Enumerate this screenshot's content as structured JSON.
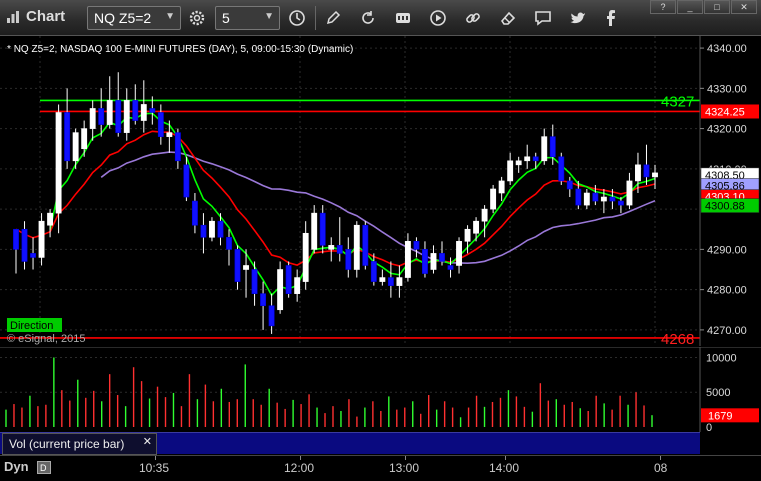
{
  "toolbar": {
    "title": "Chart",
    "symbol": "NQ Z5=2",
    "interval": "5",
    "window_controls": [
      "?",
      "_",
      "□",
      "✕"
    ]
  },
  "chart_data": [
    {
      "type": "candlestick",
      "title": "NQ Z5=2, NASDAQ 100 E-MINI FUTURES (DAY), 5, 09:00-15:30 (Dynamic)",
      "title_prefix": "*",
      "ylim": [
        4266,
        4343
      ],
      "y_ticks": [
        "4340.00",
        "4330.00",
        "4320.00",
        "4310.00",
        "4290.00",
        "4280.00",
        "4270.00"
      ],
      "x_ticks": [
        "10:35",
        "12:00",
        "13:00",
        "14:00",
        "08"
      ],
      "candles": [
        {
          "o": 4290,
          "h": 4294,
          "l": 4284,
          "c": 4295,
          "up": false
        },
        {
          "o": 4295,
          "h": 4297,
          "l": 4285,
          "c": 4287,
          "up": false
        },
        {
          "o": 4289,
          "h": 4293,
          "l": 4285,
          "c": 4288,
          "up": false
        },
        {
          "o": 4288,
          "h": 4299,
          "l": 4286,
          "c": 4297,
          "up": true
        },
        {
          "o": 4296,
          "h": 4300,
          "l": 4293,
          "c": 4299,
          "up": true
        },
        {
          "o": 4299,
          "h": 4326,
          "l": 4294,
          "c": 4324,
          "up": true
        },
        {
          "o": 4324,
          "h": 4330,
          "l": 4310,
          "c": 4312,
          "up": false
        },
        {
          "o": 4312,
          "h": 4320,
          "l": 4310,
          "c": 4319,
          "up": true
        },
        {
          "o": 4315,
          "h": 4322,
          "l": 4313,
          "c": 4320,
          "up": true
        },
        {
          "o": 4320,
          "h": 4327,
          "l": 4317,
          "c": 4325,
          "up": true
        },
        {
          "o": 4325,
          "h": 4330,
          "l": 4318,
          "c": 4321,
          "up": false
        },
        {
          "o": 4321,
          "h": 4333,
          "l": 4320,
          "c": 4327,
          "up": true
        },
        {
          "o": 4327,
          "h": 4334,
          "l": 4318,
          "c": 4319,
          "up": false
        },
        {
          "o": 4319,
          "h": 4330,
          "l": 4317,
          "c": 4327,
          "up": true
        },
        {
          "o": 4327,
          "h": 4331,
          "l": 4321,
          "c": 4322,
          "up": false
        },
        {
          "o": 4322,
          "h": 4332,
          "l": 4319,
          "c": 4326,
          "up": true
        },
        {
          "o": 4325,
          "h": 4328,
          "l": 4321,
          "c": 4324,
          "up": false
        },
        {
          "o": 4324,
          "h": 4326,
          "l": 4316,
          "c": 4318,
          "up": false
        },
        {
          "o": 4318,
          "h": 4322,
          "l": 4314,
          "c": 4319,
          "up": true
        },
        {
          "o": 4319,
          "h": 4320,
          "l": 4310,
          "c": 4312,
          "up": false
        },
        {
          "o": 4311,
          "h": 4313,
          "l": 4302,
          "c": 4303,
          "up": false
        },
        {
          "o": 4302,
          "h": 4304,
          "l": 4294,
          "c": 4296,
          "up": false
        },
        {
          "o": 4296,
          "h": 4299,
          "l": 4289,
          "c": 4293,
          "up": false
        },
        {
          "o": 4293,
          "h": 4298,
          "l": 4292,
          "c": 4297,
          "up": true
        },
        {
          "o": 4297,
          "h": 4299,
          "l": 4291,
          "c": 4293,
          "up": false
        },
        {
          "o": 4293,
          "h": 4295,
          "l": 4286,
          "c": 4290,
          "up": false
        },
        {
          "o": 4290,
          "h": 4291,
          "l": 4280,
          "c": 4282,
          "up": false
        },
        {
          "o": 4286,
          "h": 4290,
          "l": 4278,
          "c": 4285,
          "up": true
        },
        {
          "o": 4285,
          "h": 4287,
          "l": 4276,
          "c": 4279,
          "up": false
        },
        {
          "o": 4279,
          "h": 4282,
          "l": 4270,
          "c": 4276,
          "up": false
        },
        {
          "o": 4276,
          "h": 4279,
          "l": 4269,
          "c": 4271,
          "up": false
        },
        {
          "o": 4275,
          "h": 4287,
          "l": 4274,
          "c": 4285,
          "up": true
        },
        {
          "o": 4286,
          "h": 4287,
          "l": 4278,
          "c": 4279,
          "up": false
        },
        {
          "o": 4279,
          "h": 4285,
          "l": 4277,
          "c": 4283,
          "up": true
        },
        {
          "o": 4282,
          "h": 4297,
          "l": 4280,
          "c": 4294,
          "up": true
        },
        {
          "o": 4290,
          "h": 4301,
          "l": 4289,
          "c": 4299,
          "up": true
        },
        {
          "o": 4299,
          "h": 4301,
          "l": 4289,
          "c": 4291,
          "up": false
        },
        {
          "o": 4290,
          "h": 4293,
          "l": 4287,
          "c": 4291,
          "up": true
        },
        {
          "o": 4291,
          "h": 4298,
          "l": 4287,
          "c": 4289,
          "up": false
        },
        {
          "o": 4290,
          "h": 4293,
          "l": 4283,
          "c": 4285,
          "up": false
        },
        {
          "o": 4285,
          "h": 4297,
          "l": 4283,
          "c": 4296,
          "up": true
        },
        {
          "o": 4296,
          "h": 4297,
          "l": 4285,
          "c": 4286,
          "up": false
        },
        {
          "o": 4287,
          "h": 4289,
          "l": 4281,
          "c": 4282,
          "up": false
        },
        {
          "o": 4282,
          "h": 4285,
          "l": 4281,
          "c": 4283,
          "up": true
        },
        {
          "o": 4283,
          "h": 4287,
          "l": 4278,
          "c": 4281,
          "up": false
        },
        {
          "o": 4281,
          "h": 4286,
          "l": 4278,
          "c": 4283,
          "up": true
        },
        {
          "o": 4283,
          "h": 4294,
          "l": 4282,
          "c": 4292,
          "up": true
        },
        {
          "o": 4292,
          "h": 4293,
          "l": 4288,
          "c": 4290,
          "up": false
        },
        {
          "o": 4290,
          "h": 4292,
          "l": 4283,
          "c": 4284,
          "up": false
        },
        {
          "o": 4285,
          "h": 4291,
          "l": 4284,
          "c": 4289,
          "up": true
        },
        {
          "o": 4289,
          "h": 4292,
          "l": 4286,
          "c": 4287,
          "up": false
        },
        {
          "o": 4286,
          "h": 4288,
          "l": 4283,
          "c": 4285,
          "up": false
        },
        {
          "o": 4286,
          "h": 4293,
          "l": 4284,
          "c": 4292,
          "up": true
        },
        {
          "o": 4292,
          "h": 4296,
          "l": 4289,
          "c": 4295,
          "up": true
        },
        {
          "o": 4294,
          "h": 4298,
          "l": 4292,
          "c": 4297,
          "up": true
        },
        {
          "o": 4297,
          "h": 4301,
          "l": 4293,
          "c": 4300,
          "up": true
        },
        {
          "o": 4300,
          "h": 4306,
          "l": 4299,
          "c": 4305,
          "up": true
        },
        {
          "o": 4304,
          "h": 4308,
          "l": 4302,
          "c": 4307,
          "up": true
        },
        {
          "o": 4307,
          "h": 4314,
          "l": 4306,
          "c": 4312,
          "up": true
        },
        {
          "o": 4311,
          "h": 4313,
          "l": 4309,
          "c": 4312,
          "up": true
        },
        {
          "o": 4312,
          "h": 4316,
          "l": 4310,
          "c": 4313,
          "up": true
        },
        {
          "o": 4313,
          "h": 4314,
          "l": 4310,
          "c": 4312,
          "up": false
        },
        {
          "o": 4312,
          "h": 4320,
          "l": 4311,
          "c": 4318,
          "up": true
        },
        {
          "o": 4318,
          "h": 4321,
          "l": 4311,
          "c": 4313,
          "up": false
        },
        {
          "o": 4313,
          "h": 4314,
          "l": 4306,
          "c": 4307,
          "up": false
        },
        {
          "o": 4307,
          "h": 4308,
          "l": 4303,
          "c": 4305,
          "up": false
        },
        {
          "o": 4305,
          "h": 4307,
          "l": 4300,
          "c": 4301,
          "up": false
        },
        {
          "o": 4301,
          "h": 4305,
          "l": 4300,
          "c": 4304,
          "up": true
        },
        {
          "o": 4304,
          "h": 4306,
          "l": 4301,
          "c": 4302,
          "up": false
        },
        {
          "o": 4302,
          "h": 4305,
          "l": 4299,
          "c": 4303,
          "up": true
        },
        {
          "o": 4303,
          "h": 4305,
          "l": 4300,
          "c": 4302,
          "up": false
        },
        {
          "o": 4302,
          "h": 4303,
          "l": 4299,
          "c": 4301,
          "up": false
        },
        {
          "o": 4301,
          "h": 4309,
          "l": 4300,
          "c": 4307,
          "up": true
        },
        {
          "o": 4307,
          "h": 4314,
          "l": 4304,
          "c": 4311,
          "up": true
        },
        {
          "o": 4311,
          "h": 4316,
          "l": 4306,
          "c": 4308,
          "up": false
        },
        {
          "o": 4308,
          "h": 4311,
          "l": 4305,
          "c": 4309,
          "up": true
        }
      ],
      "hlines": [
        {
          "value": 4327,
          "color": "#00ff00",
          "label": "4327"
        },
        {
          "value": 4324.25,
          "color": "#ff0000",
          "label": "4324.25"
        },
        {
          "value": 4268,
          "color": "#ff0000",
          "label": "4268"
        }
      ],
      "price_tags": [
        {
          "value": 4308.5,
          "label": "4308.50",
          "bg": "#ffffff",
          "fg": "#000000"
        },
        {
          "value": 4305.86,
          "label": "4305.86",
          "bg": "#a0a0ff",
          "fg": "#000000"
        },
        {
          "value": 4303.1,
          "label": "4303.10",
          "bg": "#ff0000",
          "fg": "#ffffff"
        },
        {
          "value": 4300.88,
          "label": "4300.88",
          "bg": "#00cc00",
          "fg": "#000000"
        }
      ],
      "series_colors": {
        "ma_red": "#ff0000",
        "ma_green": "#00ff00",
        "ma_purple": "#9a78d8",
        "up": "#ffffff",
        "down": "#1010ff"
      },
      "footer_labels": {
        "direction": "Direction",
        "copyright": "© eSignal, 2015"
      }
    },
    {
      "type": "bar",
      "title": "Vol (current price bar)",
      "ylim": [
        0,
        10500
      ],
      "y_ticks": [
        "10000",
        "5000",
        "0"
      ],
      "current_value": "1679",
      "values": [
        2500,
        3300,
        2800,
        4500,
        3000,
        3200,
        10000,
        5300,
        3800,
        6800,
        4200,
        5200,
        3700,
        7600,
        4600,
        3000,
        8600,
        6600,
        4100,
        5800,
        4300,
        4900,
        3000,
        7600,
        4000,
        6100,
        3700,
        5500,
        3600,
        4000,
        9000,
        4000,
        3200,
        5500,
        3500,
        2600,
        3900,
        3300,
        4700,
        2800,
        2000,
        3000,
        2300,
        4000,
        1500,
        2800,
        3700,
        2300,
        4400,
        2500,
        2800,
        3700,
        1900,
        4600,
        2500,
        3700,
        2800,
        1400,
        2800,
        4500,
        2900,
        3600,
        4200,
        5300,
        4400,
        2900,
        2200,
        6300,
        3800,
        4000,
        3200,
        3600,
        2700,
        2300,
        4500,
        3400,
        2500,
        4500,
        3200,
        5000,
        3100,
        1700
      ],
      "colors": [
        "#ff3030",
        "#30ff30"
      ]
    }
  ]
}
